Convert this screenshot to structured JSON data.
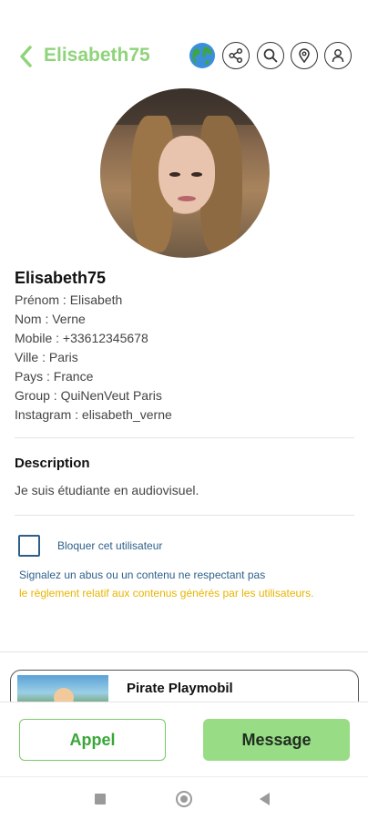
{
  "header": {
    "title": "Elisabeth75",
    "icons": [
      "back-arrow-icon",
      "globe-icon",
      "share-icon",
      "search-icon",
      "location-pin-icon",
      "person-icon"
    ]
  },
  "profile": {
    "username": "Elisabeth75",
    "fields": [
      "Prénom : Elisabeth",
      "Nom : Verne",
      "Mobile : +33612345678",
      "Ville : Paris",
      "Pays : France",
      "Group : QuiNenVeut Paris",
      "Instagram : elisabeth_verne"
    ]
  },
  "description": {
    "title": "Description",
    "text": "Je suis étudiante en audiovisuel."
  },
  "block": {
    "label": "Bloquer cet utilisateur",
    "checked": false
  },
  "report": {
    "line1": "Signalez un abus ou un contenu ne respectant pas",
    "line2": "le règlement relatif aux contenus générés par les utilisateurs."
  },
  "listing": {
    "title": "Pirate Playmobil"
  },
  "actions": {
    "call_label": "Appel",
    "message_label": "Message"
  },
  "colors": {
    "accent_green": "#8fd47a",
    "button_green": "#98dc86",
    "link_blue": "#2e5f8a",
    "warning_yellow": "#e8b400"
  }
}
